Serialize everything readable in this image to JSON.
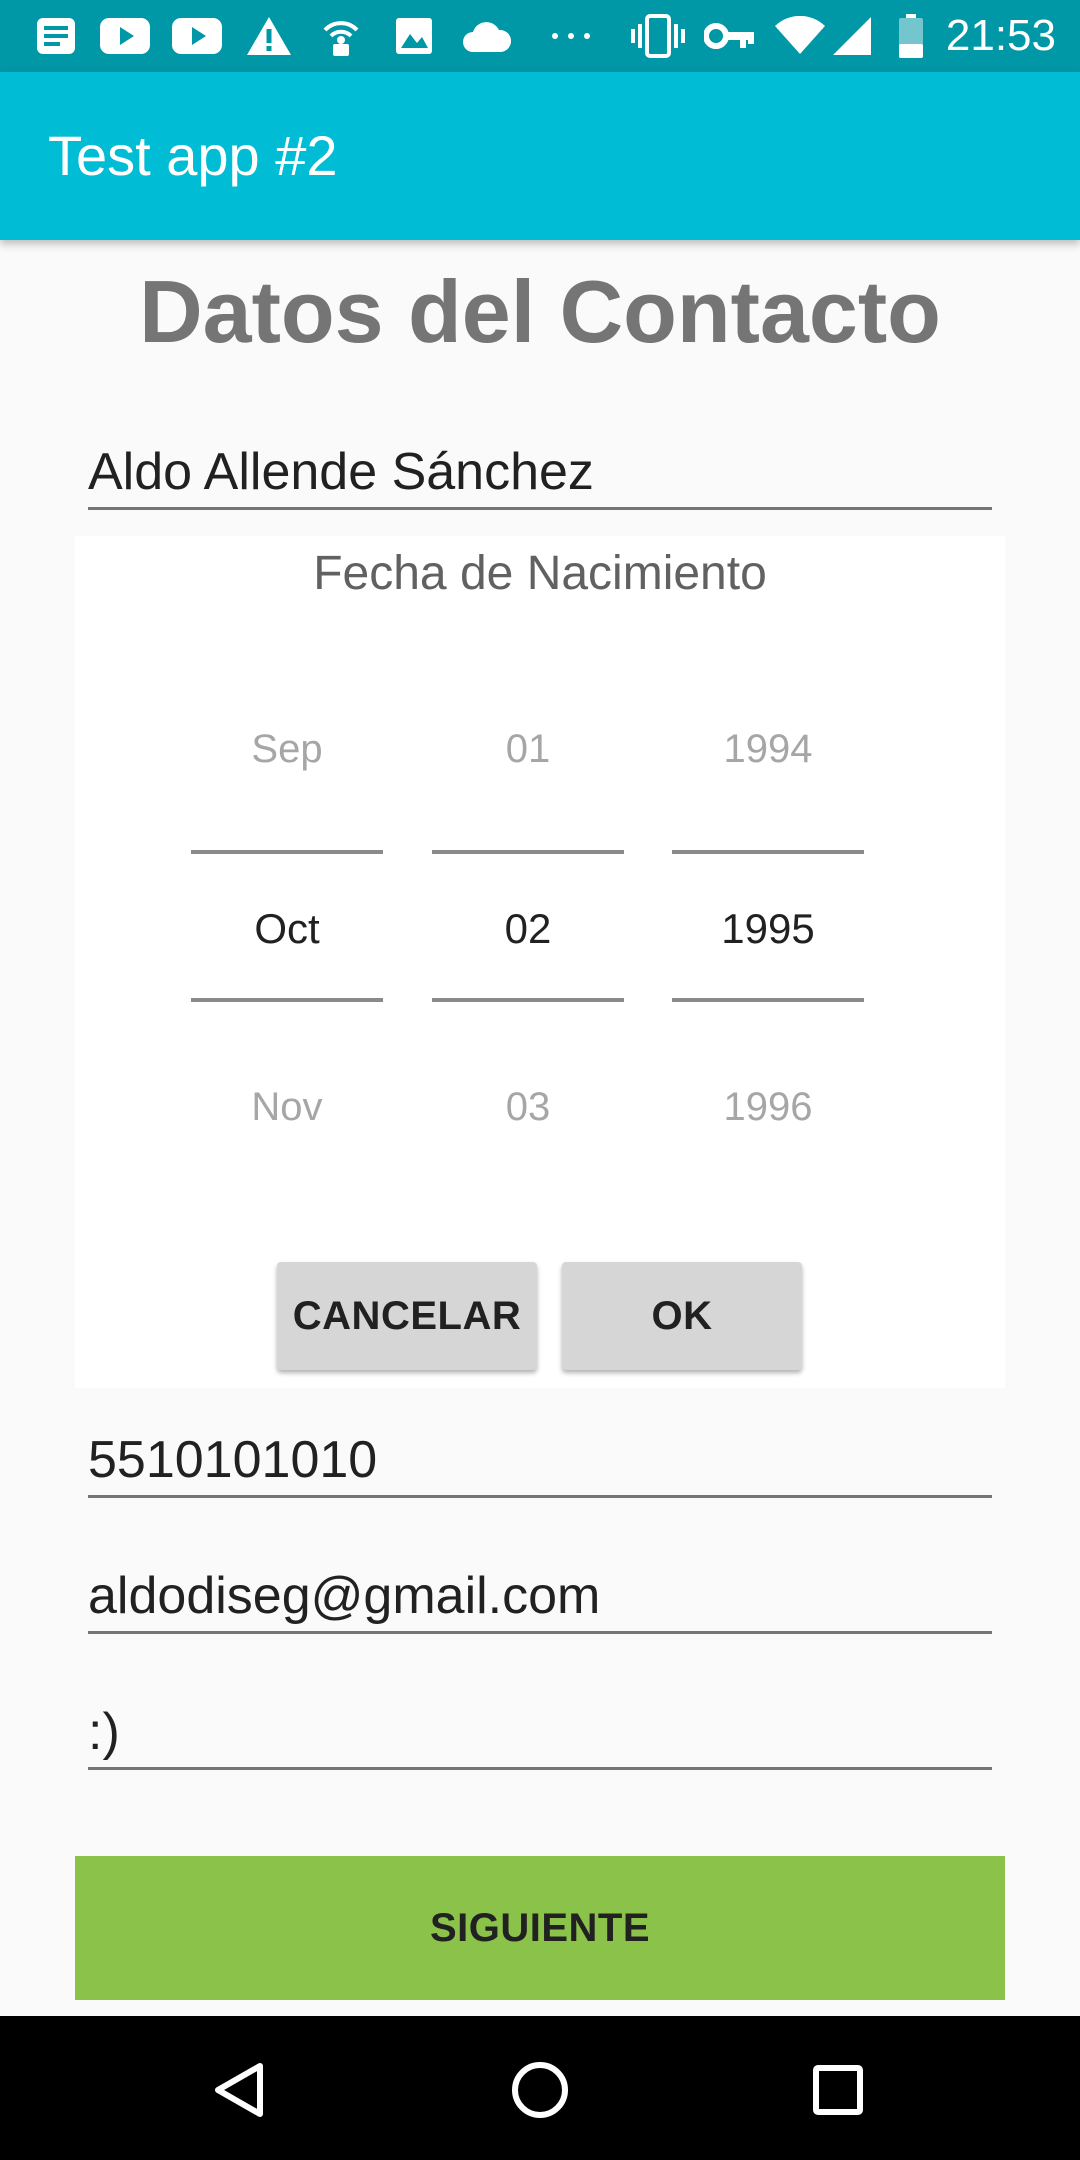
{
  "status_bar": {
    "time": "21:53",
    "icons": [
      "news-icon",
      "youtube-icon",
      "youtube-icon",
      "warning-icon",
      "wifi-tethering-icon",
      "image-icon",
      "cloud-icon",
      "more-icon",
      "vibrate-icon",
      "vpn-key-icon",
      "wifi-icon",
      "signal-icon",
      "battery-icon"
    ]
  },
  "app_bar": {
    "title": "Test app #2"
  },
  "page": {
    "title": "Datos del Contacto"
  },
  "form": {
    "name": "Aldo Allende Sánchez",
    "phone": "5510101010",
    "email": "aldodiseg@gmail.com",
    "description": ":)",
    "next_label": "SIGUIENTE"
  },
  "date_picker": {
    "title": "Fecha de Nacimiento",
    "month": {
      "prev": "Sep",
      "current": "Oct",
      "next": "Nov"
    },
    "day": {
      "prev": "01",
      "current": "02",
      "next": "03"
    },
    "year": {
      "prev": "1994",
      "current": "1995",
      "next": "1996"
    },
    "cancel_label": "CANCELAR",
    "ok_label": "OK"
  },
  "nav_bar": {
    "icons": [
      "back-icon",
      "home-icon",
      "recents-icon"
    ]
  },
  "colors": {
    "status_bar": "#0097a7",
    "app_bar": "#00bcd4",
    "next_button": "#8bc34a"
  }
}
